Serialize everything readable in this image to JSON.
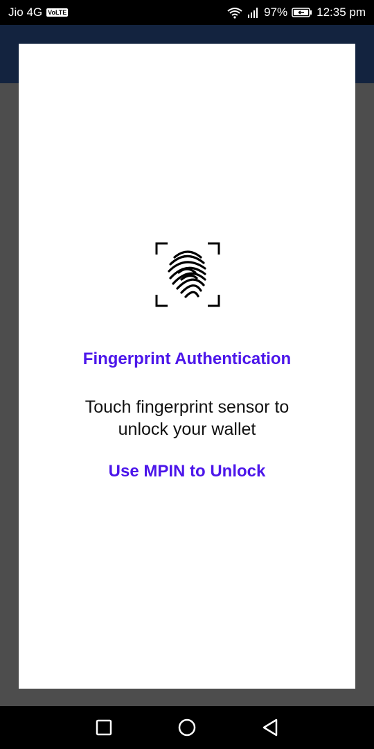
{
  "status_bar": {
    "carrier": "Jio 4G",
    "volte": "VoLTE",
    "battery_percent": "97%",
    "time": "12:35 pm",
    "icons": [
      "wifi-icon",
      "signal-icon",
      "battery-icon"
    ]
  },
  "dialog": {
    "icon": "fingerprint-icon",
    "title": "Fingerprint Authentication",
    "message": "Touch fingerprint sensor to unlock your wallet",
    "mpin_link": "Use MPIN to Unlock"
  },
  "nav_bar": {
    "buttons": [
      "recents-button",
      "home-button",
      "back-button"
    ]
  },
  "colors": {
    "accent": "#4c16ea",
    "app_bar": "#13233f",
    "scrim": "#4d4d4d"
  }
}
